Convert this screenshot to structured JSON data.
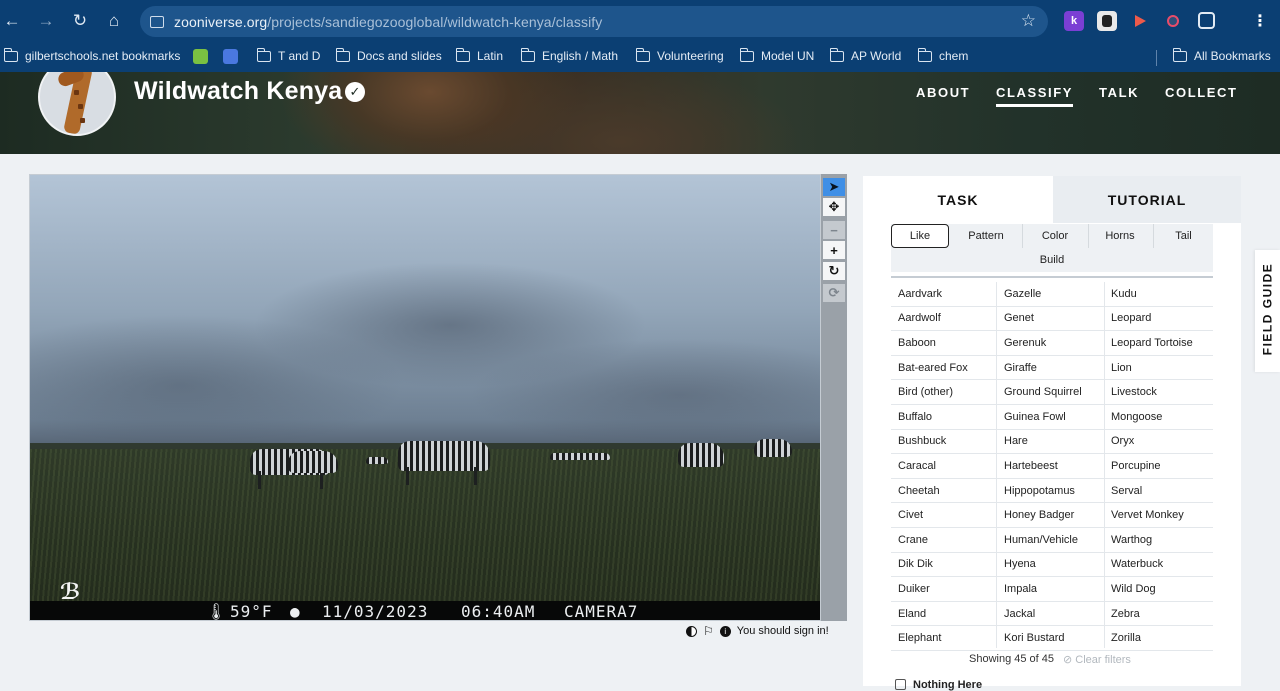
{
  "browser": {
    "url_host": "zooniverse.org",
    "url_path": "/projects/sandiegozooglobal/wildwatch-kenya/classify",
    "bookmarks": [
      {
        "label": "gilbertschools.net bookmarks"
      },
      {
        "label": "T and D"
      },
      {
        "label": "Docs and slides"
      },
      {
        "label": "Latin"
      },
      {
        "label": "English / Math"
      },
      {
        "label": "Volunteering"
      },
      {
        "label": "Model UN"
      },
      {
        "label": "AP World"
      },
      {
        "label": "chem"
      }
    ],
    "all_bookmarks": "All Bookmarks",
    "extensions": [
      {
        "icon": "k-extension-icon",
        "text": "k",
        "color": "#7b3fd4"
      },
      {
        "icon": "person-extension-icon",
        "text": "",
        "color": "#e9e9e9"
      },
      {
        "icon": "arrow-extension-icon",
        "text": "",
        "color": "#ee5a4a"
      },
      {
        "icon": "dot-extension-icon",
        "text": "",
        "color": "#2d4f7a"
      }
    ]
  },
  "project": {
    "title": "Wildwatch Kenya",
    "nav": [
      {
        "label": "ABOUT",
        "active": false
      },
      {
        "label": "CLASSIFY",
        "active": true
      },
      {
        "label": "TALK",
        "active": false
      },
      {
        "label": "COLLECT",
        "active": false
      }
    ]
  },
  "camera": {
    "temperature": "59°F",
    "date": "11/03/2023",
    "time": "06:40AM",
    "camera_id": "CAMERA7"
  },
  "viewer": {
    "sign_in_message": "You should sign in!"
  },
  "task_panel": {
    "tabs": [
      {
        "label": "TASK",
        "active": true
      },
      {
        "label": "TUTORIAL",
        "active": false
      }
    ],
    "filters": [
      {
        "label": "Like",
        "active": true
      },
      {
        "label": "Pattern",
        "active": false
      },
      {
        "label": "Color",
        "active": false
      },
      {
        "label": "Horns",
        "active": false
      },
      {
        "label": "Tail",
        "active": false
      },
      {
        "label": "Build",
        "active": false
      }
    ],
    "choices": [
      [
        "Aardvark",
        "Gazelle",
        "Kudu"
      ],
      [
        "Aardwolf",
        "Genet",
        "Leopard"
      ],
      [
        "Baboon",
        "Gerenuk",
        "Leopard Tortoise"
      ],
      [
        "Bat-eared Fox",
        "Giraffe",
        "Lion"
      ],
      [
        "Bird (other)",
        "Ground Squirrel",
        "Livestock"
      ],
      [
        "Buffalo",
        "Guinea Fowl",
        "Mongoose"
      ],
      [
        "Bushbuck",
        "Hare",
        "Oryx"
      ],
      [
        "Caracal",
        "Hartebeest",
        "Porcupine"
      ],
      [
        "Cheetah",
        "Hippopotamus",
        "Serval"
      ],
      [
        "Civet",
        "Honey Badger",
        "Vervet Monkey"
      ],
      [
        "Crane",
        "Human/Vehicle",
        "Warthog"
      ],
      [
        "Dik Dik",
        "Hyena",
        "Waterbuck"
      ],
      [
        "Duiker",
        "Impala",
        "Wild Dog"
      ],
      [
        "Eland",
        "Jackal",
        "Zebra"
      ],
      [
        "Elephant",
        "Kori Bustard",
        "Zorilla"
      ]
    ],
    "showing": "Showing 45 of 45",
    "clear_filters": "Clear filters",
    "nothing_here": "Nothing Here"
  },
  "field_guide": "FIELD GUIDE",
  "colors": {
    "chrome": "#0b3f73",
    "omnibox": "#1e558c",
    "active_tool": "#3f8fe6",
    "page_bg": "#eef1f4"
  }
}
